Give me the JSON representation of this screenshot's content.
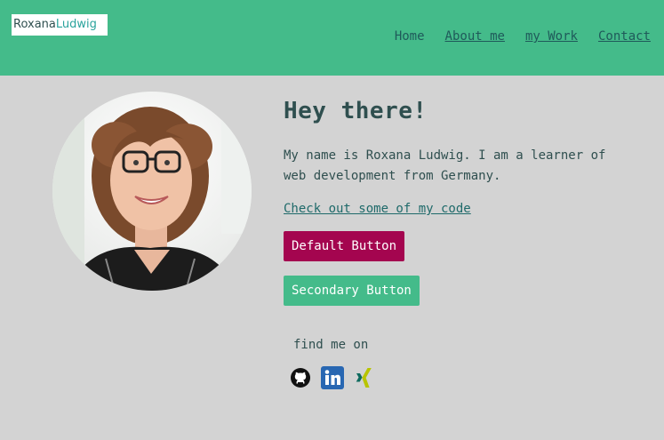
{
  "header": {
    "logo_first": "Roxana",
    "logo_last": "Ludwig",
    "nav": [
      "Home",
      "About me",
      "my Work",
      "Contact"
    ]
  },
  "main": {
    "heading": "Hey there!",
    "intro": "My name is Roxana Ludwig. I am a learner of web development from Germany.",
    "code_link": "Check out some of my code",
    "default_button": "Default Button",
    "secondary_button": "Secondary Button",
    "find_me_label": "find me on"
  },
  "socials": [
    "github-icon",
    "linkedin-icon",
    "xing-icon"
  ],
  "colors": {
    "header": "#44bb8a",
    "background": "#d3d3d3",
    "default_button": "#a4054f",
    "secondary_button": "#44bb8a",
    "text": "#2f4f4f"
  }
}
